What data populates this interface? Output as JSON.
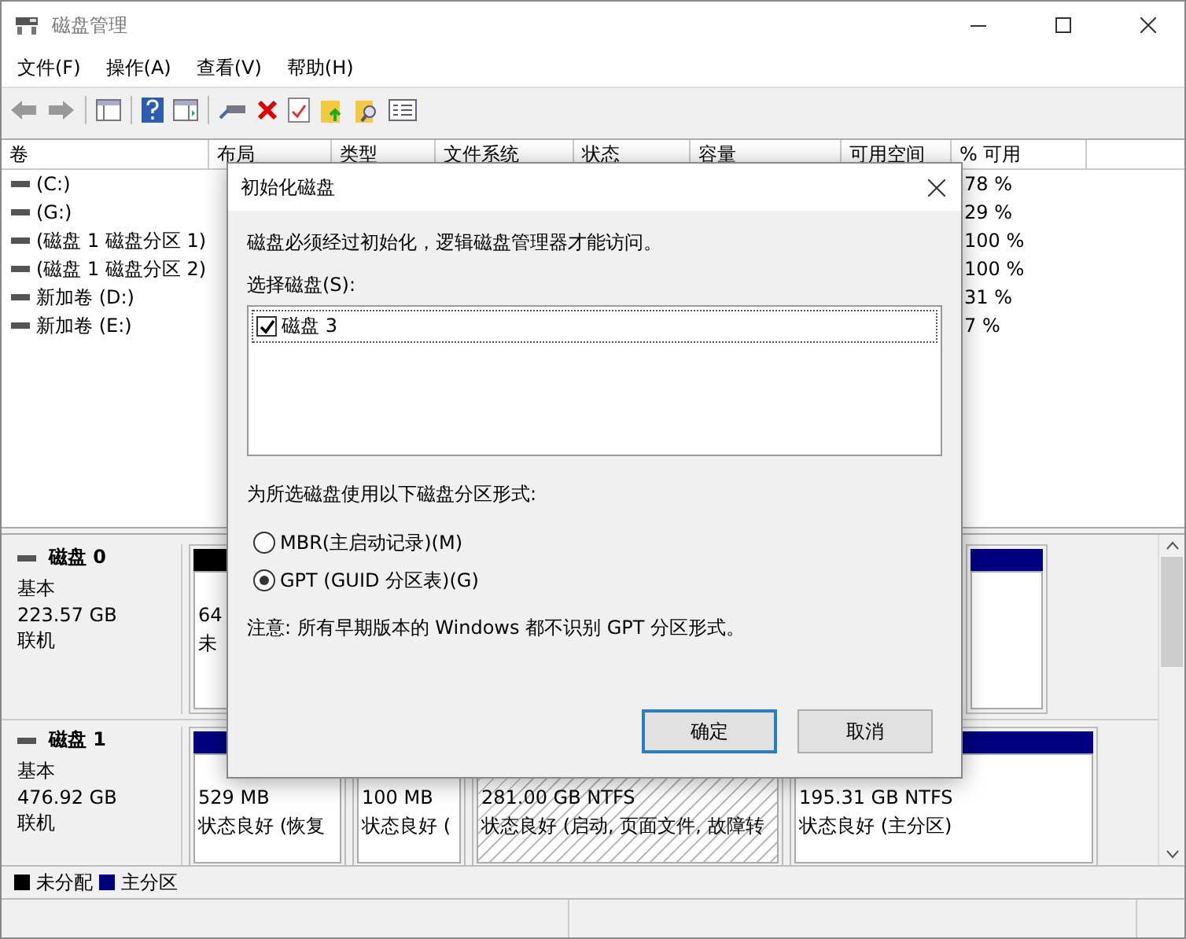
{
  "window": {
    "title": "磁盘管理"
  },
  "menu": [
    "文件(F)",
    "操作(A)",
    "查看(V)",
    "帮助(H)"
  ],
  "table": {
    "columns": [
      "卷",
      "布局",
      "类型",
      "文件系统",
      "状态",
      "容量",
      "可用空间",
      "% 可用"
    ],
    "rows": [
      {
        "volume": "(C:)",
        "free_pct": "78 %"
      },
      {
        "volume": "(G:)",
        "free_pct": "29 %"
      },
      {
        "volume": "(磁盘 1 磁盘分区 1)",
        "free_pct": "100 %"
      },
      {
        "volume": "(磁盘 1 磁盘分区 2)",
        "free_pct": "100 %"
      },
      {
        "volume": "新加卷 (D:)",
        "free_pct": "31 %"
      },
      {
        "volume": "新加卷 (E:)",
        "free_pct": "7 %"
      }
    ]
  },
  "disks": [
    {
      "name": "磁盘 0",
      "type": "基本",
      "size": "223.57 GB",
      "status": "联机",
      "partitions": [
        {
          "kind": "unallocated",
          "selected": false,
          "lines": [
            "64",
            "未"
          ]
        },
        {
          "kind": "primary",
          "selected": false
        }
      ]
    },
    {
      "name": "磁盘 1",
      "type": "基本",
      "size": "476.92 GB",
      "status": "联机",
      "partitions": [
        {
          "kind": "primary",
          "selected": false,
          "lines": [
            "529 MB",
            "状态良好 (恢复"
          ]
        },
        {
          "selected": false,
          "lines": [
            "100 MB",
            "状态良好 ("
          ]
        },
        {
          "selected": true,
          "lines": [
            "281.00 GB NTFS",
            "状态良好 (启动, 页面文件, 故障转"
          ]
        },
        {
          "kind": "primary",
          "selected": false,
          "lines": [
            "195.31 GB NTFS",
            "状态良好 (主分区)"
          ]
        }
      ]
    }
  ],
  "legend": [
    {
      "label": "未分配",
      "color": "#000000"
    },
    {
      "label": "主分区",
      "color": "#000080"
    }
  ],
  "dialog": {
    "title": "初始化磁盘",
    "message": "磁盘必须经过初始化，逻辑磁盘管理器才能访问。",
    "select_label": "选择磁盘(S):",
    "disks": [
      {
        "label": "磁盘 3",
        "checked": true
      }
    ],
    "format_label": "为所选磁盘使用以下磁盘分区形式:",
    "options": [
      {
        "label": "MBR(主启动记录)(M)",
        "selected": false
      },
      {
        "label": "GPT (GUID 分区表)(G)",
        "selected": true
      }
    ],
    "note": "注意: 所有早期版本的 Windows 都不识别 GPT 分区形式。",
    "buttons": [
      {
        "label": "确定",
        "default": true
      },
      {
        "label": "取消",
        "default": false
      }
    ]
  }
}
